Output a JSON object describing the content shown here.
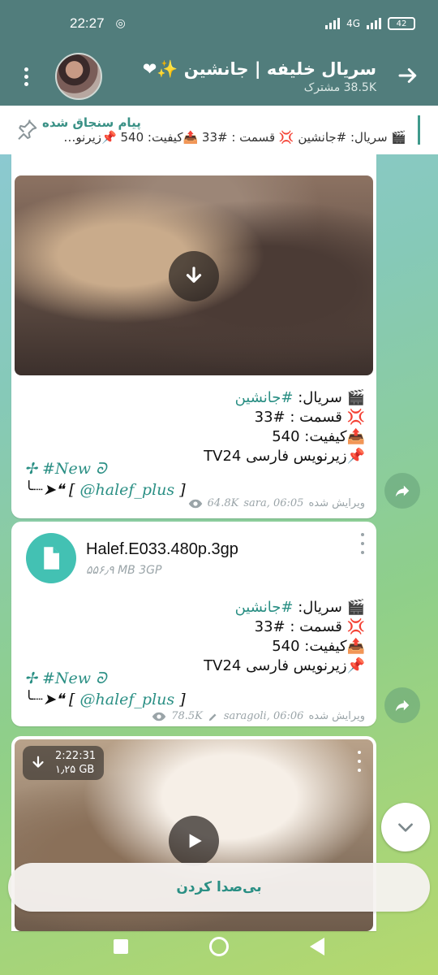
{
  "status": {
    "time": "22:27",
    "network": "4G",
    "battery": "42"
  },
  "header": {
    "title": "سریال خلیفه | جانشین ✨❤",
    "subscribers": "38.5K مشترک"
  },
  "pinned": {
    "label": "پیام سنجاق شده",
    "preview": "🎬 سریال: #جانشین 💢 قسمت : #33 📤کیفیت: 540 📌زیرنو…"
  },
  "messages": [
    {
      "caption": {
        "series": "🎬 سریال: ",
        "series_tag": "#جانشین",
        "episode": "💢 قسمت : #33",
        "quality": "📤کیفیت: 540",
        "subtitle": "📌زیرنویس فارسی TV24",
        "new_line": "✢ #New ᘐ",
        "handle_prefix": "╰┈➤❝ [ ",
        "handle": "@halef_plus",
        "handle_suffix": " ]"
      },
      "meta": {
        "views": "64.8K",
        "author_time": "sara, 06:05",
        "edited": "ویرایش شده"
      }
    },
    {
      "file": {
        "name": "Halef.E033.480p.3gp",
        "size": "۵۵۶٫۹ MB 3GP"
      },
      "caption": {
        "series": "🎬 سریال: ",
        "series_tag": "#جانشین",
        "episode": "💢 قسمت : #33",
        "quality": "📤کیفیت: 540",
        "subtitle": "📌زیرنویس فارسی TV24",
        "new_line": "✢ #New ᘐ",
        "handle_prefix": "╰┈➤❝ [ ",
        "handle": "@halef_plus",
        "handle_suffix": " ]"
      },
      "meta": {
        "views": "78.5K",
        "author_time": "saragoli, 06:06",
        "edited": "ویرایش شده"
      }
    },
    {
      "video": {
        "duration": "2:22:31",
        "size": "۱٫۲۵ GB"
      }
    }
  ],
  "mute_button": "بی‌صدا کردن",
  "colors": {
    "header": "#517d7c",
    "accent": "#2a8f84",
    "file_icon": "#43c1b3"
  }
}
